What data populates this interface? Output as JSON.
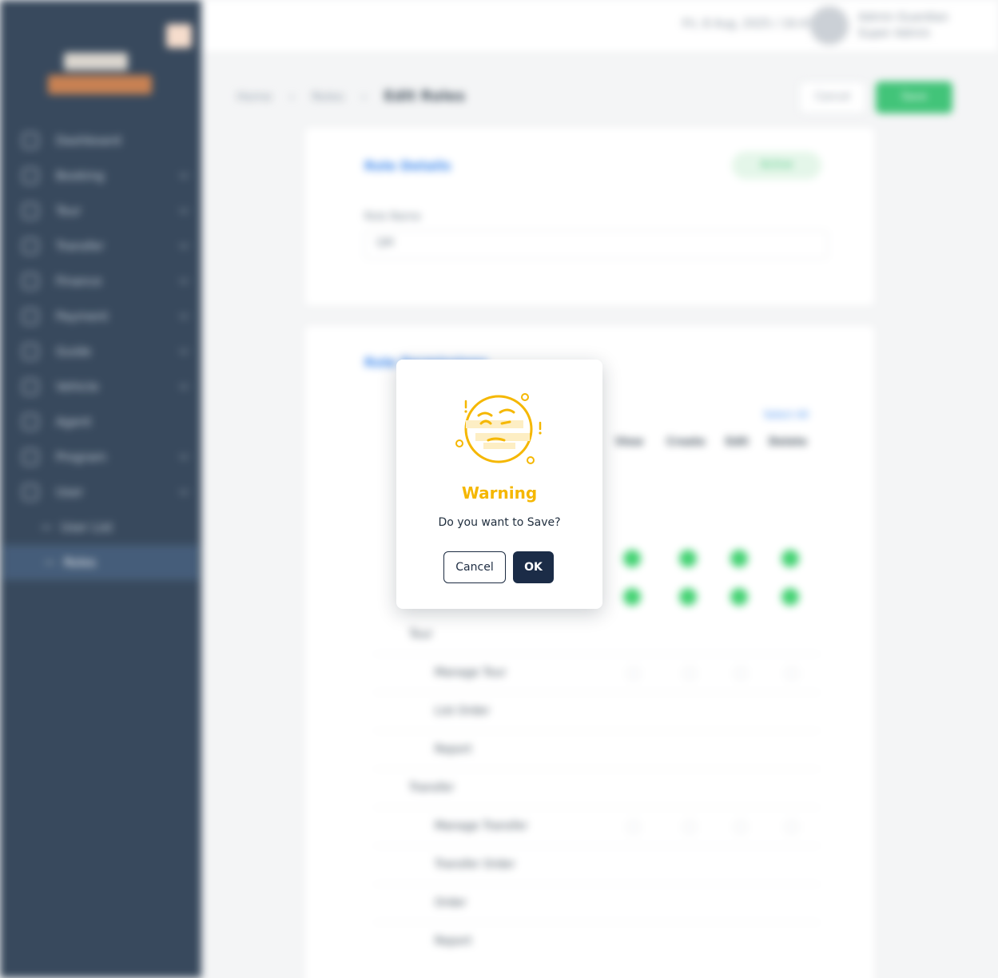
{
  "background": {
    "sidebar": {
      "items": [
        {
          "label": "Dashboard"
        },
        {
          "label": "Booking"
        },
        {
          "label": "Tour"
        },
        {
          "label": "Transfer"
        },
        {
          "label": "Finance"
        },
        {
          "label": "Payment"
        },
        {
          "label": "Guide"
        },
        {
          "label": "Vehicle"
        },
        {
          "label": "Agent"
        },
        {
          "label": "Program"
        },
        {
          "label": "User"
        }
      ],
      "subitems": [
        {
          "label": "User List"
        },
        {
          "label": "Roles"
        }
      ]
    },
    "topbar": {
      "date": "Fri, 8 Aug, 2025 / 16:41",
      "user_name": "Admin Guardian",
      "user_role": "Super Admin"
    },
    "breadcrumb": {
      "home": "Home",
      "parent": "Roles",
      "current": "Edit Roles"
    },
    "actions": {
      "cancel": "Cancel",
      "save": "Save"
    },
    "role_card": {
      "title": "Role Details",
      "status": "Active",
      "field_label": "Role Name",
      "field_value": "QM"
    },
    "perm_card": {
      "title": "Role Permissions",
      "select_all": "Select All",
      "columns": [
        "View",
        "Create",
        "Edit",
        "Delete"
      ],
      "rows": [
        "Tour",
        "Manage Tour",
        "List Order",
        "Report",
        "Transfer",
        "Manage Transfer",
        "Transfer Order",
        "Order",
        "Report"
      ]
    }
  },
  "modal": {
    "icon": "worried-face-icon",
    "title": "Warning",
    "message": "Do you want to Save?",
    "cancel_label": "Cancel",
    "ok_label": "OK",
    "colors": {
      "title": "#f5b700",
      "ok_bg": "#1b2c47",
      "icon": "#f5b700"
    }
  }
}
